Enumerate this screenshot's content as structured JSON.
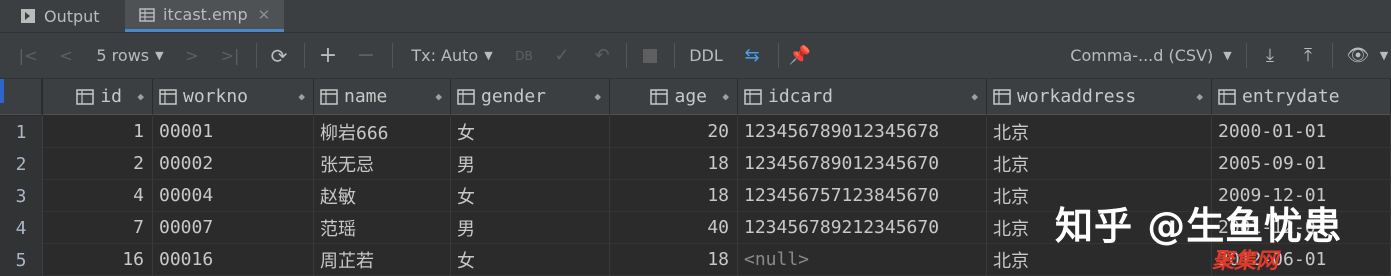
{
  "tabs": [
    {
      "label": "Output",
      "icon": "terminal-icon",
      "active": false
    },
    {
      "label": "itcast.emp",
      "icon": "table-icon",
      "active": true
    }
  ],
  "toolbar": {
    "rows_label": "5 rows",
    "tx_label": "Tx: Auto",
    "ddl_label": "DDL",
    "export_format": "Comma-...d (CSV)"
  },
  "columns": [
    {
      "name": "id"
    },
    {
      "name": "workno"
    },
    {
      "name": "name"
    },
    {
      "name": "gender"
    },
    {
      "name": "age"
    },
    {
      "name": "idcard"
    },
    {
      "name": "workaddress"
    },
    {
      "name": "entrydate"
    }
  ],
  "rows": [
    {
      "num": "1",
      "id": "1",
      "workno": "00001",
      "name": "柳岩666",
      "gender": "女",
      "age": "20",
      "idcard": "123456789012345678",
      "workaddress": "北京",
      "entrydate": "2000-01-01"
    },
    {
      "num": "2",
      "id": "2",
      "workno": "00002",
      "name": "张无忌",
      "gender": "男",
      "age": "18",
      "idcard": "123456789012345670",
      "workaddress": "北京",
      "entrydate": "2005-09-01"
    },
    {
      "num": "3",
      "id": "4",
      "workno": "00004",
      "name": "赵敏",
      "gender": "女",
      "age": "18",
      "idcard": "123456757123845670",
      "workaddress": "北京",
      "entrydate": "2009-12-01"
    },
    {
      "num": "4",
      "id": "7",
      "workno": "00007",
      "name": "范瑶",
      "gender": "男",
      "age": "40",
      "idcard": "123456789212345670",
      "workaddress": "北京",
      "entrydate": "2001-12-01"
    },
    {
      "num": "5",
      "id": "16",
      "workno": "00016",
      "name": "周芷若",
      "gender": "女",
      "age": "18",
      "idcard": "<null>",
      "workaddress": "北京",
      "entrydate": "2012-06-01"
    }
  ],
  "watermark": {
    "text": "知乎 @生鱼忧患",
    "sub": "聚集网"
  }
}
